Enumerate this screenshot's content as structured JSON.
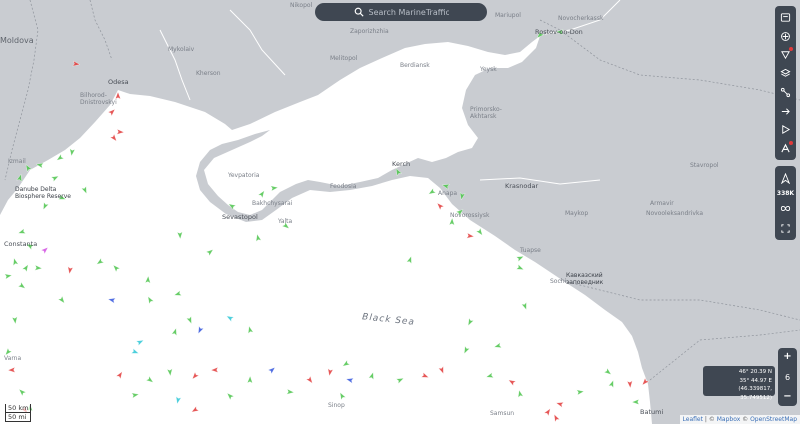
{
  "search": {
    "placeholder": "Search MarineTraffic"
  },
  "places": {
    "moldova": "Moldova",
    "odesa": "Odesa",
    "bilhorod": "Bilhorod-\nDnistrovskyi",
    "mykolaiv": "Mykolaiv",
    "kherson": "Kherson",
    "zaporizhzhia": "Zaporizhzhia",
    "melitopol": "Melitopol",
    "berdiansk": "Berdiansk",
    "mariupol": "Mariupol",
    "yeysk": "Yeysk",
    "rostov": "Rostov-on-Don",
    "nikopol": "Nikopol",
    "novocherkassk": "Novocherkassk",
    "primorsko": "Primorsko-\nAkhtarsk",
    "krasnodar": "Krasnodar",
    "kerch": "Kerch",
    "yevpatoria": "Yevpatoria",
    "sevastopol": "Sevastopol",
    "bakhchysarai": "Bakhchysarai",
    "feodosia": "Feodosia",
    "yalta": "Yalta",
    "novorossiysk": "Novorossiysk",
    "anapa": "Anapa",
    "tuapse": "Tuapse",
    "sochi": "Sochi",
    "kavkaz": "Кавказский\nзаповедник",
    "danube": "Danube Delta\nBiosphere Reserve",
    "constanta": "Constanta",
    "varna": "Varna",
    "sinop": "Sinop",
    "samsun": "Samsun",
    "batumi": "Batumi",
    "black_sea": "Black Sea",
    "stavropol": "Stavropol",
    "maykop": "Maykop",
    "armavir": "Armavir",
    "novooleksandrivka": "Novooleksandrivka",
    "izmail": "Izmail"
  },
  "tools": {
    "vessel_count": "338K",
    "icons": [
      "filter-icon",
      "layers-icon",
      "weather-icon",
      "stack-icon",
      "route-icon",
      "measure-icon",
      "play-icon",
      "ais-icon"
    ]
  },
  "zoom": {
    "plus": "+",
    "level": "6",
    "minus": "−"
  },
  "coords": {
    "lat": "46° 20.39 N",
    "lon": "35° 44.97 E",
    "decimal": "(46.339817, 35.749512)"
  },
  "scale": {
    "label": "50 km",
    "label2": "50 mi"
  },
  "attribution": {
    "leaflet": "Leaflet",
    "sep": " | © ",
    "mapbox": "Mapbox",
    "osm": "OpenStreetMap"
  },
  "colors": {
    "land": "#c9ccd1",
    "sea": "#ffffff",
    "vessel_cargo": "#4cc44c",
    "vessel_tanker": "#e23a3a",
    "vessel_passenger": "#3355dd",
    "vessel_tug": "#2ec7d6",
    "vessel_pleasure": "#d14ce0"
  }
}
